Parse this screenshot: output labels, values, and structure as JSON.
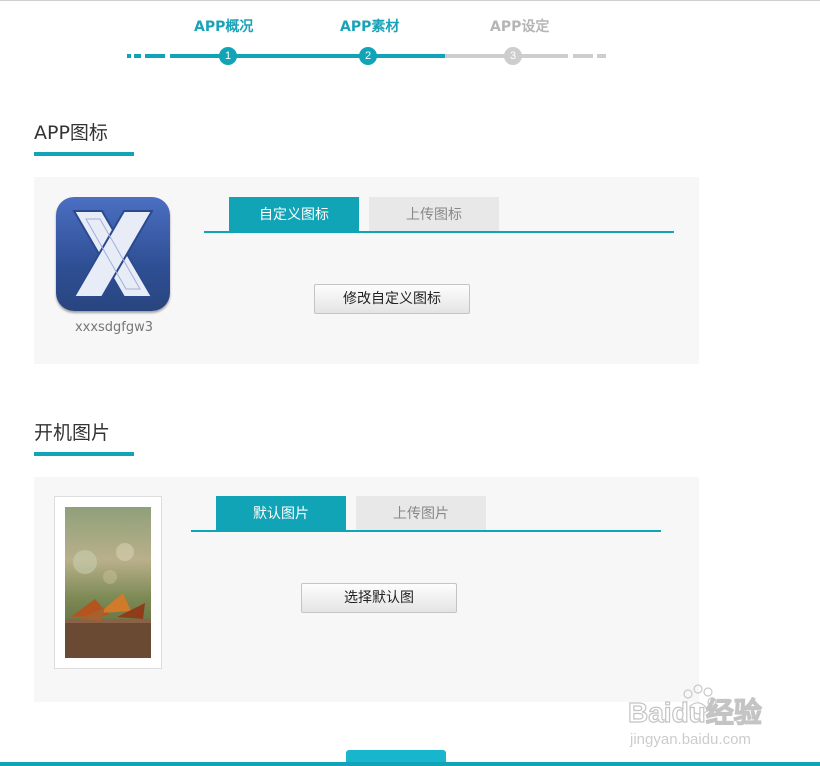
{
  "stepper": {
    "steps": [
      {
        "label": "APP概况",
        "number": "1",
        "state": "complete"
      },
      {
        "label": "APP素材",
        "number": "2",
        "state": "current"
      },
      {
        "label": "APP设定",
        "number": "3",
        "state": "pending"
      }
    ]
  },
  "icon_section": {
    "title": "APP图标",
    "app_name": "xxxsdgfgw3",
    "tabs": [
      "自定义图标",
      "上传图标"
    ],
    "active_tab": 0,
    "button_label": "修改自定义图标"
  },
  "splash_section": {
    "title": "开机图片",
    "tabs": [
      "默认图片",
      "上传图片"
    ],
    "active_tab": 0,
    "button_label": "选择默认图"
  },
  "watermark": {
    "brand": "Baidu经验",
    "url": "jingyan.baidu.com"
  },
  "colors": {
    "accent": "#11a3b6",
    "inactive": "#cdcdcd",
    "panel_bg": "#f7f7f7"
  }
}
